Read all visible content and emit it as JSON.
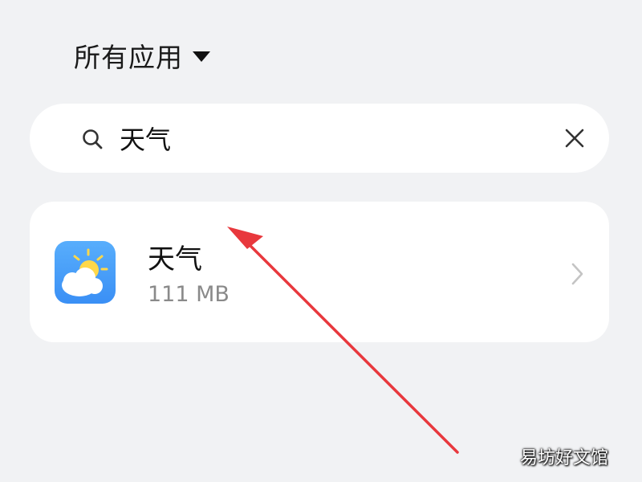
{
  "filter": {
    "label": "所有应用"
  },
  "search": {
    "query": "天气"
  },
  "app": {
    "name": "天气",
    "size": "111 MB"
  },
  "watermark": "易坊好文馆",
  "colors": {
    "background": "#f1f2f4",
    "card": "#ffffff",
    "annotation_arrow": "#e8383d",
    "app_icon": "#4a9df8"
  },
  "icons": {
    "filter": "caret-down-icon",
    "search": "search-icon",
    "clear": "close-icon",
    "app": "weather-app-icon",
    "open": "chevron-right-icon"
  }
}
